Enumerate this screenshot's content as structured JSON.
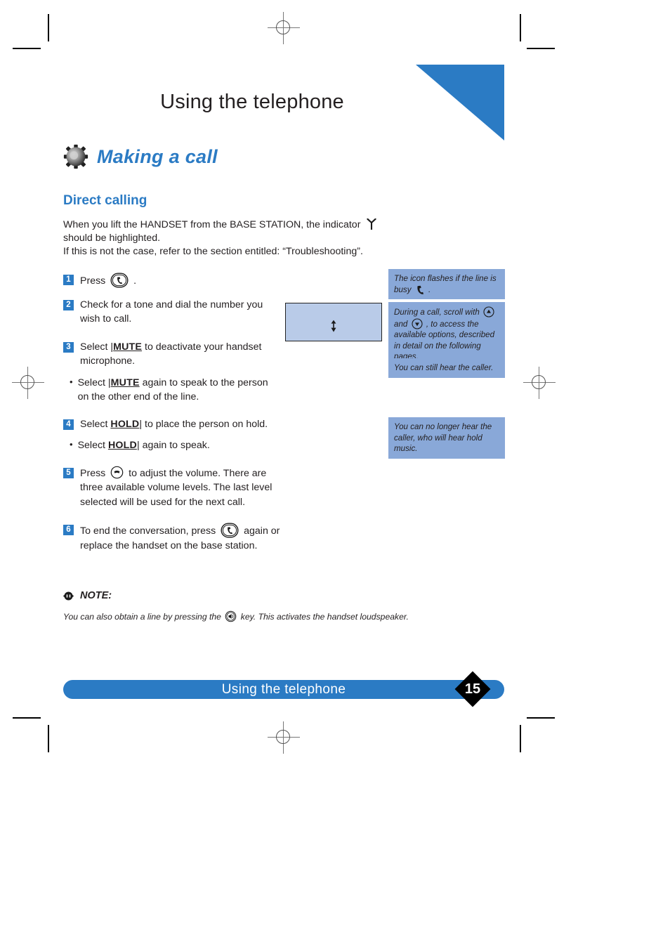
{
  "document": {
    "chapter_title": "Using the telephone",
    "section_title": "Making a call",
    "section_icon": "gear-icon",
    "subsection_title": "Direct calling",
    "accent_color": "#2b7bc4",
    "callout_color": "#89a8d8",
    "lcd_color": "#b9cbe8"
  },
  "intro": {
    "line1_before": "When you lift the HANDSET from the BASE STATION, the indicator",
    "line1_icon": "antenna-icon",
    "line2": "should be highlighted.",
    "line3": "If this is not the case, refer to the section entitled: “Troubleshooting”."
  },
  "steps": [
    {
      "num": "1",
      "before": "Press",
      "icon": "phone-key-icon",
      "after": "."
    },
    {
      "num": "2",
      "text": "Check for a tone and dial the number you wish to call."
    },
    {
      "num": "3",
      "before": "Select |",
      "keyword": "MUTE",
      "after": " to deactivate your handset microphone.",
      "sub": {
        "bullet": "•",
        "before": "Select |",
        "keyword": "MUTE",
        "after": " again to speak to the person on the other end of the line."
      }
    },
    {
      "num": "4",
      "before": "Select ",
      "keyword": "HOLD",
      "after": "| to place the person on hold.",
      "sub": {
        "bullet": "•",
        "before": "Select ",
        "keyword": "HOLD",
        "after": "| again to speak."
      }
    },
    {
      "num": "5",
      "before": "Press",
      "icon": "volume-key-icon",
      "after": "to adjust the volume. There are three available volume levels. The last level selected will be used for the next call."
    },
    {
      "num": "6",
      "before": "To end the conversation, press",
      "icon": "phone-key-icon",
      "after": "again or replace the handset on the base station."
    }
  ],
  "lcd_illustration": {
    "label": "handset-display",
    "icon": "up-down-arrow-icon"
  },
  "callouts": [
    {
      "id": "callout-1",
      "text_before": "The icon flashes if the line is busy",
      "icon": "handset-icon",
      "text_after": "."
    },
    {
      "id": "callout-2",
      "text_part1": "During a call, scroll with",
      "icon1": "scroll-up-icon",
      "text_part2": "and",
      "icon2": "scroll-down-icon",
      "text_part3": ", to access the available options, described in detail on the following pages."
    },
    {
      "id": "callout-3",
      "text": "You can still hear the caller."
    },
    {
      "id": "callout-4",
      "text": "You can no longer hear the caller, who will hear hold music."
    }
  ],
  "note": {
    "icon": "note-icon",
    "heading": "NOTE:",
    "body_before": "You can also obtain a line by pressing the",
    "icon_inline": "speaker-key-icon",
    "body_after": "key. This activates the handset loudspeaker."
  },
  "footer": {
    "title": "Using the telephone",
    "page_number": "15"
  }
}
